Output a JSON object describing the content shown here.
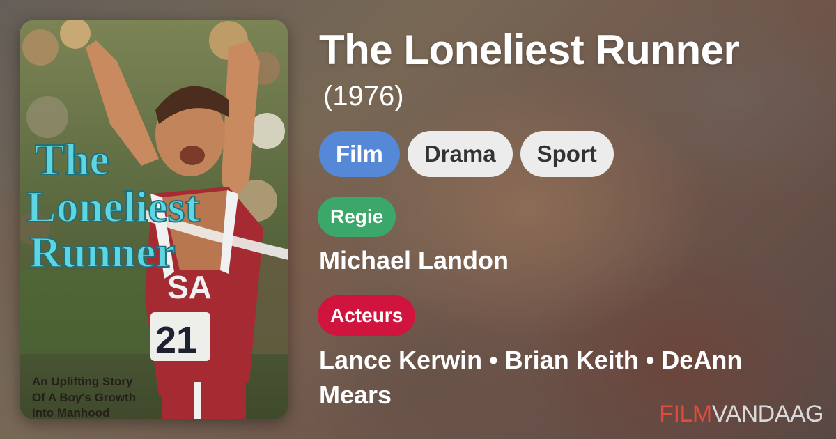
{
  "movie": {
    "title": "The Loneliest Runner",
    "year": "(1976)",
    "tags": [
      "Film",
      "Drama",
      "Sport"
    ],
    "director_label": "Regie",
    "director": "Michael Landon",
    "cast_label": "Acteurs",
    "cast": "Lance Kerwin • Brian Keith • DeAnn Mears"
  },
  "poster": {
    "title_line1": "The",
    "title_line2": "Loneliest",
    "title_line3": "Runner",
    "tagline_line1": "An Uplifting Story",
    "tagline_line2": "Of A Boy's Growth",
    "tagline_line3": "Into Manhood",
    "jersey_letters": "SA",
    "bib_number": "21"
  },
  "brand": {
    "part1": "FILM",
    "part2": "VANDAAG"
  },
  "colors": {
    "film_tag": "#5589d8",
    "genre_tag": "#ececec",
    "regie_label": "#3ba86a",
    "acteurs_label": "#d0143d",
    "brand_accent": "#e24b3c"
  }
}
